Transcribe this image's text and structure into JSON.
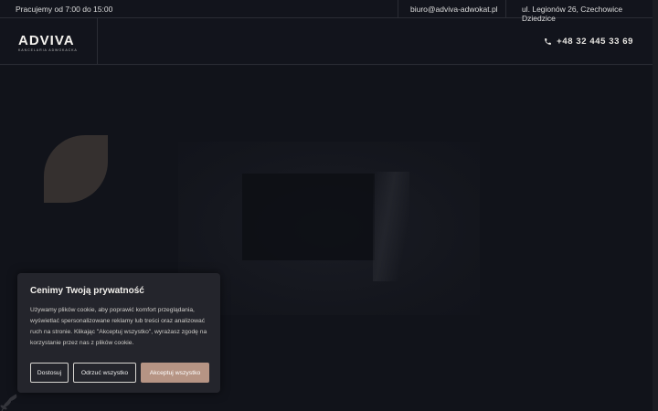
{
  "topbar": {
    "hours": "Pracujemy od 7:00 do 15:00",
    "email": "biuro@adviva-adwokat.pl",
    "address": "ul. Legionów 26, Czechowice Dziedzice"
  },
  "header": {
    "logo_word": "ADVIVA",
    "logo_sub": "Kancelaria Adwokacka",
    "phone": "+48 32 445 33 69"
  },
  "icons": {
    "phone": "phone-icon",
    "leaf": "leaf-shape",
    "plant": "plant-icon"
  },
  "colors": {
    "background": "#12141c",
    "leaf": "#35302f",
    "accent": "#b69484",
    "popup": "#24252c"
  },
  "cookie": {
    "title": "Cenimy Twoją prywatność",
    "text": "Używamy plików cookie, aby poprawić komfort przeglądania, wyświetlać spersonalizowane reklamy lub treści oraz analizować ruch na stronie. Klikając \"Akceptuj wszystko\", wyrażasz zgodę na korzystanie przez nas z plików cookie.",
    "customize_label": "Dostosuj",
    "reject_label": "Odrzuć wszystko",
    "accept_label": "Akceptuj wszystko"
  }
}
